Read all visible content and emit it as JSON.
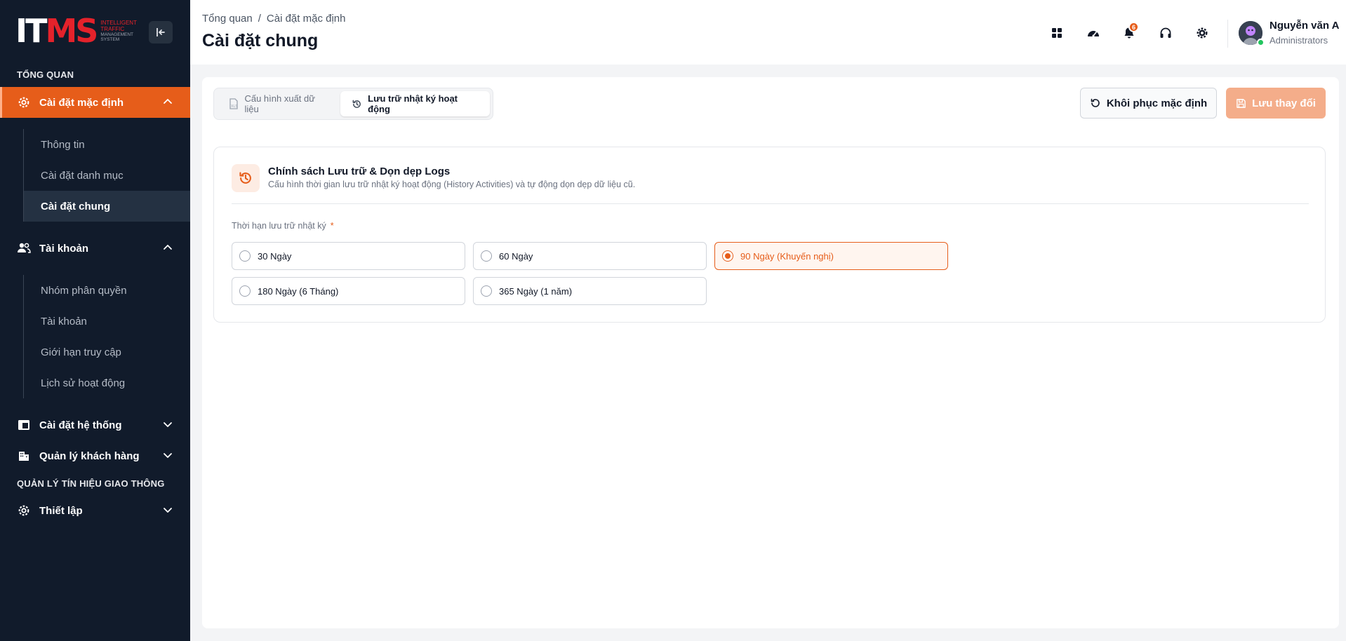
{
  "brand": {
    "logo_mark_a": "IT",
    "logo_mark_b": "MS",
    "logo_line1": "INTELLIGENT",
    "logo_line2": "TRAFFIC",
    "logo_line3": "MANAGEMENT",
    "logo_line4": "SYSTEM"
  },
  "sidebar": {
    "section_overview": "TỔNG QUAN",
    "default_settings": "Cài đặt mặc định",
    "default_sub": [
      "Thông tin",
      "Cài đặt danh mục",
      "Cài đặt chung"
    ],
    "accounts": "Tài khoản",
    "accounts_sub": [
      "Nhóm phân quyền",
      "Tài khoản",
      "Giới hạn truy cập",
      "Lịch sử hoạt động"
    ],
    "system_settings": "Cài đặt hệ thống",
    "customers": "Quản lý khách hàng",
    "section_signal": "QUẢN LÝ TÍN HIỆU GIAO THÔNG",
    "setup": "Thiết lập"
  },
  "header": {
    "breadcrumb_root": "Tổng quan",
    "breadcrumb_sep": "/",
    "breadcrumb_current": "Cài đặt mặc định",
    "title": "Cài đặt chung",
    "notification_count": "6",
    "user_name": "Nguyễn văn A",
    "user_role": "Administrators"
  },
  "tabs": {
    "export": "Cấu hình xuất dữ liệu",
    "logs": "Lưu trữ nhật ký hoạt động",
    "active": "logs"
  },
  "actions": {
    "restore": "Khôi phục mặc định",
    "save": "Lưu thay đổi"
  },
  "card": {
    "title": "Chính sách Lưu trữ & Dọn dẹp Logs",
    "description": "Cấu hình thời gian lưu trữ nhật ký hoạt động (History Activities) và tự động dọn dẹp dữ liệu cũ.",
    "field_label": "Thời hạn lưu trữ nhật ký",
    "required_mark": "*",
    "options": [
      "30 Ngày",
      "60 Ngày",
      "90 Ngày (Khuyến nghị)",
      "180 Ngày (6 Tháng)",
      "365 Ngày (1 năm)"
    ],
    "selected_index": 2
  },
  "colors": {
    "accent": "#e65d1a",
    "sidebar_bg": "#111b2b",
    "save_disabled": "#f4ad8a"
  }
}
